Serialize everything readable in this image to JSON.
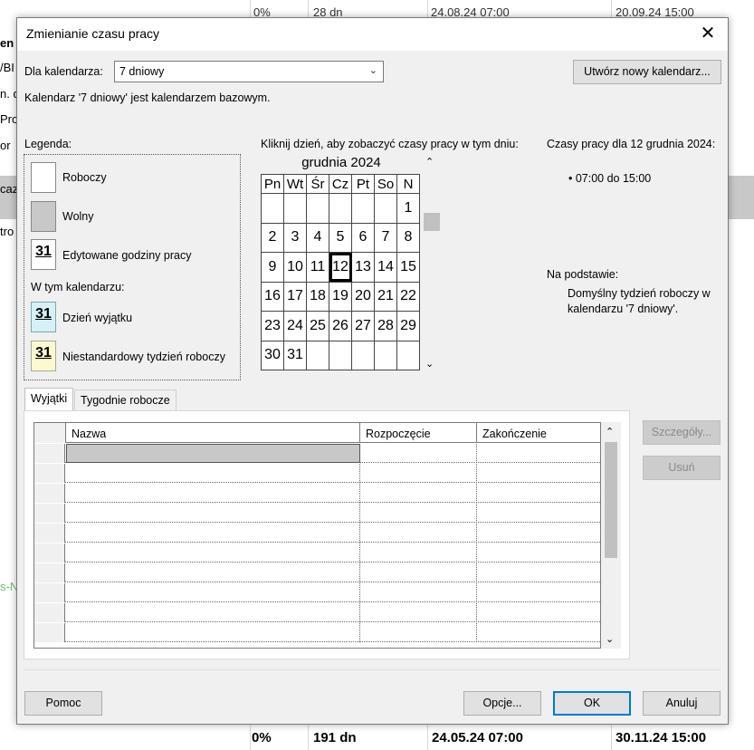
{
  "background": {
    "top_cells": [
      "0%",
      "28 dn",
      "24.08.24 07:00",
      "20.09.24 15:00"
    ],
    "left_frags": [
      "en",
      "/BI",
      "n. d",
      "Pro",
      "or",
      "caz",
      "tro",
      "s-N"
    ],
    "bottom_cells": [
      "0%",
      "191 dn",
      "24.05.24 07:00",
      "30.11.24 15:00"
    ]
  },
  "dialog": {
    "title": "Zmienianie czasu pracy",
    "calendar_label": "Dla kalendarza:",
    "calendar_value": "7 dniowy",
    "new_calendar_button": "Utwórz nowy kalendarz...",
    "base_info": "Kalendarz '7 dniowy' jest kalendarzem bazowym.",
    "legend": {
      "title": "Legenda:",
      "working": "Roboczy",
      "nonworking": "Wolny",
      "edited": "Edytowane godziny pracy",
      "edited_num": "31",
      "in_this_calendar": "W tym kalendarzu:",
      "exception": "Dzień wyjątku",
      "exception_num": "31",
      "custom_week": "Niestandardowy tydzień roboczy",
      "custom_week_num": "31"
    },
    "calendar_instruction": "Kliknij dzień, aby zobaczyć czasy pracy w tym dniu:",
    "month_title": "grudnia 2024",
    "weekdays": [
      "Pn",
      "Wt",
      "Śr",
      "Cz",
      "Pt",
      "So",
      "N"
    ],
    "weeks": [
      [
        "",
        "",
        "",
        "",
        "",
        "",
        "1"
      ],
      [
        "2",
        "3",
        "4",
        "5",
        "6",
        "7",
        "8"
      ],
      [
        "9",
        "10",
        "11",
        "12",
        "13",
        "14",
        "15"
      ],
      [
        "16",
        "17",
        "18",
        "19",
        "20",
        "21",
        "22"
      ],
      [
        "23",
        "24",
        "25",
        "26",
        "27",
        "28",
        "29"
      ],
      [
        "30",
        "31",
        "",
        "",
        "",
        "",
        ""
      ]
    ],
    "selected_day": "12",
    "work_times_title": "Czasy pracy dla 12 grudnia 2024:",
    "work_times": [
      "• 07:00 do 15:00"
    ],
    "based_on_label": "Na podstawie:",
    "based_on_text_1": "Domyślny tydzień roboczy w",
    "based_on_text_2": "kalendarzu '7 dniowy'.",
    "tabs": [
      "Wyjątki",
      "Tygodnie robocze"
    ],
    "active_tab": "Wyjątki",
    "grid_columns": [
      "Nazwa",
      "Rozpoczęcie",
      "Zakończenie"
    ],
    "details_button": "Szczegóły...",
    "delete_button": "Usuń",
    "help_button": "Pomoc",
    "options_button": "Opcje...",
    "ok_button": "OK",
    "cancel_button": "Anuluj"
  }
}
